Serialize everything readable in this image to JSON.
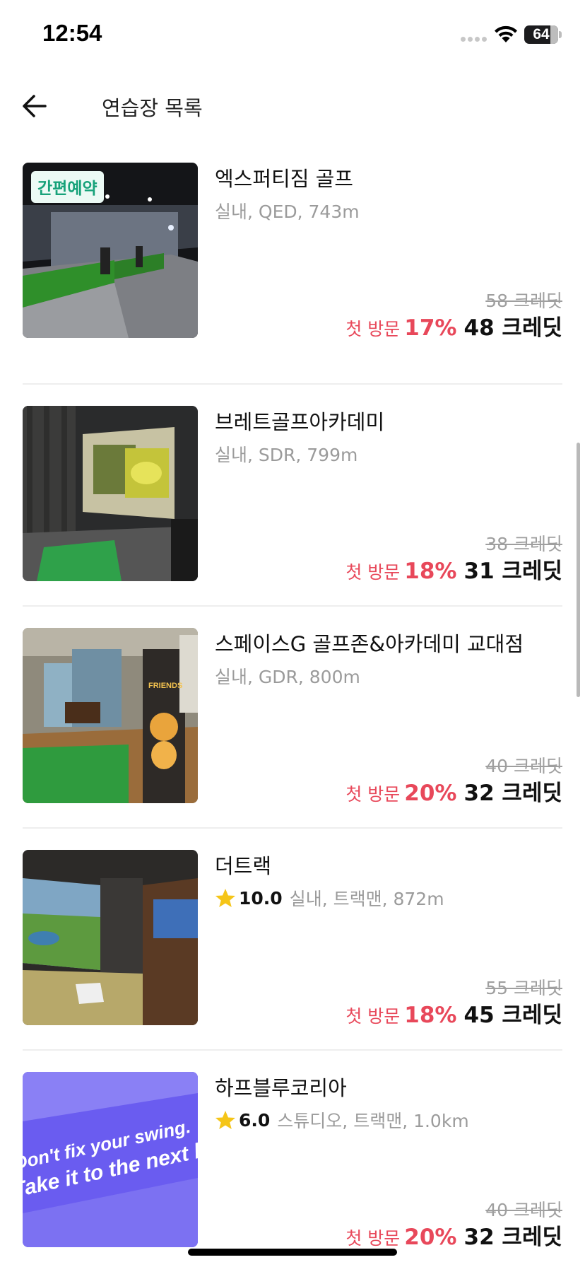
{
  "status_bar": {
    "time": "12:54",
    "battery": "64",
    "icons": [
      "signal-dots-icon",
      "wifi-icon",
      "battery-icon"
    ]
  },
  "header": {
    "title": "연습장 목록",
    "back_icon": "arrow-left-icon"
  },
  "items": [
    {
      "badge": "간편예약",
      "name": "엑스퍼티짐 골프",
      "rating": "",
      "meta": "실내, QED, 743m",
      "original_price": "58 크레딧",
      "promo_label": "첫 방문",
      "discount": "17%",
      "final_price": "48 크레딧"
    },
    {
      "badge": "",
      "name": "브레트골프아카데미",
      "rating": "",
      "meta": "실내, SDR, 799m",
      "original_price": "38 크레딧",
      "promo_label": "첫 방문",
      "discount": "18%",
      "final_price": "31 크레딧"
    },
    {
      "badge": "",
      "name": "스페이스G 골프존&아카데미 교대점",
      "rating": "",
      "meta": "실내, GDR, 800m",
      "original_price": "40 크레딧",
      "promo_label": "첫 방문",
      "discount": "20%",
      "final_price": "32 크레딧"
    },
    {
      "badge": "",
      "name": "더트랙",
      "rating": "10.0",
      "meta": "실내, 트랙맨, 872m",
      "original_price": "55 크레딧",
      "promo_label": "첫 방문",
      "discount": "18%",
      "final_price": "45 크레딧"
    },
    {
      "badge": "",
      "name": "하프블루코리아",
      "rating": "6.0",
      "meta": "스튜디오, 트랙맨, 1.0km",
      "original_price": "40 크레딧",
      "promo_label": "첫 방문",
      "discount": "20%",
      "final_price": "32 크레딧"
    }
  ],
  "photo_text": {
    "banner_line1": "Don't fix your swing.",
    "banner_line2": "Take it to the next level",
    "standee": "FRIENDS"
  },
  "colors": {
    "promo": "#e8485a",
    "badge_text": "#17a27a",
    "badge_bg": "#ecfaf5",
    "star": "#f5c518",
    "muted": "#9b9b9b"
  }
}
